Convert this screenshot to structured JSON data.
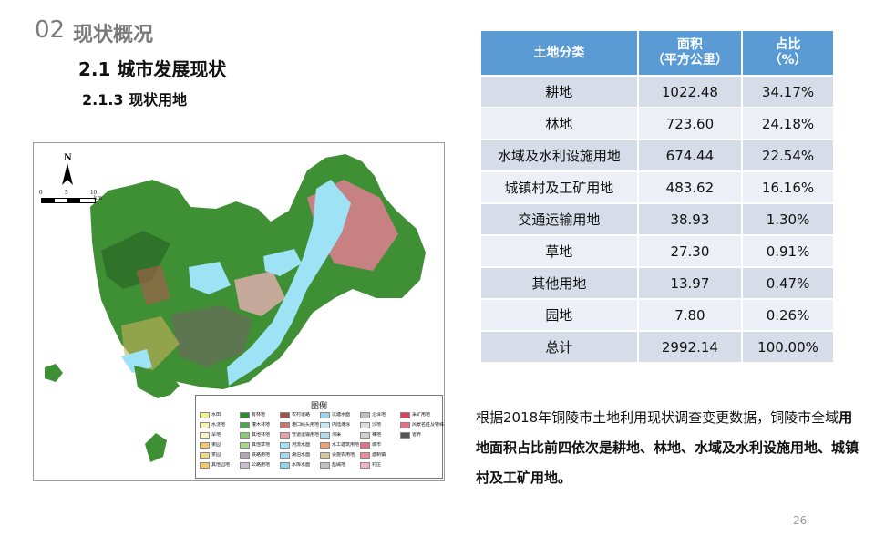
{
  "header": {
    "section_number": "02",
    "section_title": "现状概况",
    "subtitle_1": "2.1 城市发展现状",
    "subtitle_2": "2.1.3 现状用地"
  },
  "map": {
    "north_label": "N",
    "scale_ticks": [
      "0",
      "5",
      "10"
    ],
    "scale_unit": "km",
    "legend": {
      "title": "图例",
      "items": [
        {
          "label": "水田",
          "color": "#f5ee8c"
        },
        {
          "label": "水浇地",
          "color": "#f6f2b0"
        },
        {
          "label": "旱地",
          "color": "#f7f4c8"
        },
        {
          "label": "果园",
          "color": "#f2c96a"
        },
        {
          "label": "茶园",
          "color": "#f0d789"
        },
        {
          "label": "其他园地",
          "color": "#f3c86d"
        },
        {
          "label": "有林地",
          "color": "#2e8b2e"
        },
        {
          "label": "灌木林地",
          "color": "#4fa84f"
        },
        {
          "label": "其他林地",
          "color": "#8cc97a"
        },
        {
          "label": "其他草地",
          "color": "#a5d88c"
        },
        {
          "label": "铁路用地",
          "color": "#b1a6b8"
        },
        {
          "label": "公路用地",
          "color": "#c8bdd0"
        },
        {
          "label": "农村道路",
          "color": "#a0524d"
        },
        {
          "label": "港口码头用地",
          "color": "#c97a6e"
        },
        {
          "label": "管道运输用地",
          "color": "#e7a1a9"
        },
        {
          "label": "河流水面",
          "color": "#9ee3f5"
        },
        {
          "label": "湖泊水面",
          "color": "#a7d9ef"
        },
        {
          "label": "水库水面",
          "color": "#8fd5ec"
        },
        {
          "label": "坑塘水面",
          "color": "#99d3ee"
        },
        {
          "label": "内陆滩涂",
          "color": "#c3e7f3"
        },
        {
          "label": "沟渠",
          "color": "#b2dbec"
        },
        {
          "label": "水工建筑用地",
          "color": "#f0a072"
        },
        {
          "label": "设施农用地",
          "color": "#d7c5a0"
        },
        {
          "label": "盐碱地",
          "color": "#c0c0c0"
        },
        {
          "label": "沼泽地",
          "color": "#bfbfbf"
        },
        {
          "label": "沙地",
          "color": "#dddddd"
        },
        {
          "label": "裸地",
          "color": "#d0d0d0"
        },
        {
          "label": "城市",
          "color": "#e36f80"
        },
        {
          "label": "建制镇",
          "color": "#ea8c99"
        },
        {
          "label": "村庄",
          "color": "#f0b3bd"
        },
        {
          "label": "采矿用地",
          "color": "#d9425a"
        },
        {
          "label": "风景名胜及特殊用地",
          "color": "#e66f89"
        },
        {
          "label": "省界",
          "color": "#555555"
        }
      ]
    }
  },
  "table": {
    "headers": [
      "土地分类",
      "面积\n（平方公里）",
      "占比\n（%）"
    ],
    "rows": [
      {
        "category": "耕地",
        "area": "1022.48",
        "ratio": "34.17%"
      },
      {
        "category": "林地",
        "area": "723.60",
        "ratio": "24.18%"
      },
      {
        "category": "水域及水利设施用地",
        "area": "674.44",
        "ratio": "22.54%"
      },
      {
        "category": "城镇村及工矿用地",
        "area": "483.62",
        "ratio": "16.16%"
      },
      {
        "category": "交通运输用地",
        "area": "38.93",
        "ratio": "1.30%"
      },
      {
        "category": "草地",
        "area": "27.30",
        "ratio": "0.91%"
      },
      {
        "category": "其他用地",
        "area": "13.97",
        "ratio": "0.47%"
      },
      {
        "category": "园地",
        "area": "7.80",
        "ratio": "0.26%"
      },
      {
        "category": "总计",
        "area": "2992.14",
        "ratio": "100.00%"
      }
    ]
  },
  "summary": {
    "part1": "根据2018年铜陵市土地利用现状调查变更数据，铜陵市全域",
    "part2": "用地面积占比前四依次是耕地、林地、水域及水利设施用地、城镇村及工矿用地。"
  },
  "page_number": "26",
  "colors": {
    "table_header": "#5b9bd5",
    "row_odd": "#d6dde9",
    "row_even": "#ecf0f6",
    "section_gray": "#7a7a7a"
  }
}
